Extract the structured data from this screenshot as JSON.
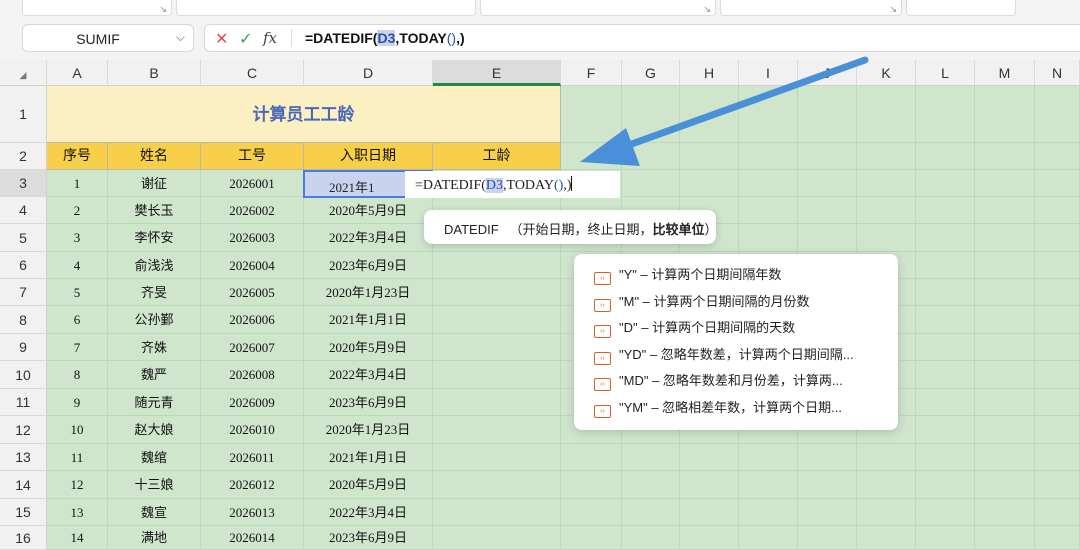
{
  "namebox": {
    "value": "SUMIF"
  },
  "formula_bar": {
    "cancel_icon": "✕",
    "confirm_icon": "✓",
    "fx_label": "fx",
    "prefix": "=DATEDIF(",
    "ref": "D3",
    "mid": ",TODAY",
    "paren": "()",
    "tail": ",)"
  },
  "columns": [
    "A",
    "B",
    "C",
    "D",
    "E",
    "F",
    "G",
    "H",
    "I",
    "J",
    "K",
    "L",
    "M",
    "N"
  ],
  "rows": [
    "1",
    "2",
    "3",
    "4",
    "5",
    "6",
    "7",
    "8",
    "9",
    "10",
    "11",
    "12",
    "13",
    "14",
    "15",
    "16"
  ],
  "sheet": {
    "title": "计算员工工龄",
    "headers": [
      "序号",
      "姓名",
      "工号",
      "入职日期",
      "工龄"
    ],
    "records": [
      [
        "1",
        "谢征",
        "2026001",
        "2021年1"
      ],
      [
        "2",
        "樊长玉",
        "2026002",
        "2020年5月9日"
      ],
      [
        "3",
        "李怀安",
        "2026003",
        "2022年3月4日"
      ],
      [
        "4",
        "俞浅浅",
        "2026004",
        "2023年6月9日"
      ],
      [
        "5",
        "齐旻",
        "2026005",
        "2020年1月23日"
      ],
      [
        "6",
        "公孙鄞",
        "2026006",
        "2021年1月1日"
      ],
      [
        "7",
        "齐姝",
        "2026007",
        "2020年5月9日"
      ],
      [
        "8",
        "魏严",
        "2026008",
        "2022年3月4日"
      ],
      [
        "9",
        "随元青",
        "2026009",
        "2023年6月9日"
      ],
      [
        "10",
        "赵大娘",
        "2026010",
        "2020年1月23日"
      ],
      [
        "11",
        "魏绾",
        "2026011",
        "2021年1月1日"
      ],
      [
        "12",
        "十三娘",
        "2026012",
        "2020年5月9日"
      ],
      [
        "13",
        "魏宣",
        "2026013",
        "2022年3月4日"
      ],
      [
        "14",
        "满地",
        "2026014",
        "2023年6月9日"
      ]
    ]
  },
  "cell_editor": {
    "prefix": "=DATEDIF(",
    "ref": "D3",
    "mid": ",TODAY",
    "paren": "()",
    "tail": ",)"
  },
  "hint": {
    "fn": "DATEDIF",
    "args": "（开始日期，终止日期，",
    "current_arg": "比较单位",
    "close": "）"
  },
  "options": [
    "\"Y\" – 计算两个日期间隔年数",
    "\"M\" – 计算两个日期间隔的月份数",
    "\"D\" – 计算两个日期间隔的天数",
    "\"YD\" – 忽略年数差，计算两个日期间隔...",
    "\"MD\" – 忽略年数差和月份差，计算两...",
    "\"YM\" – 忽略相差年数，计算两个日期..."
  ],
  "colors": {
    "header_fill": "#f7cf49",
    "title_fill": "#fcf0c2",
    "grid_green": "#cfe6cd",
    "arrow": "#4a90d9",
    "accent": "#1f8a4c"
  }
}
